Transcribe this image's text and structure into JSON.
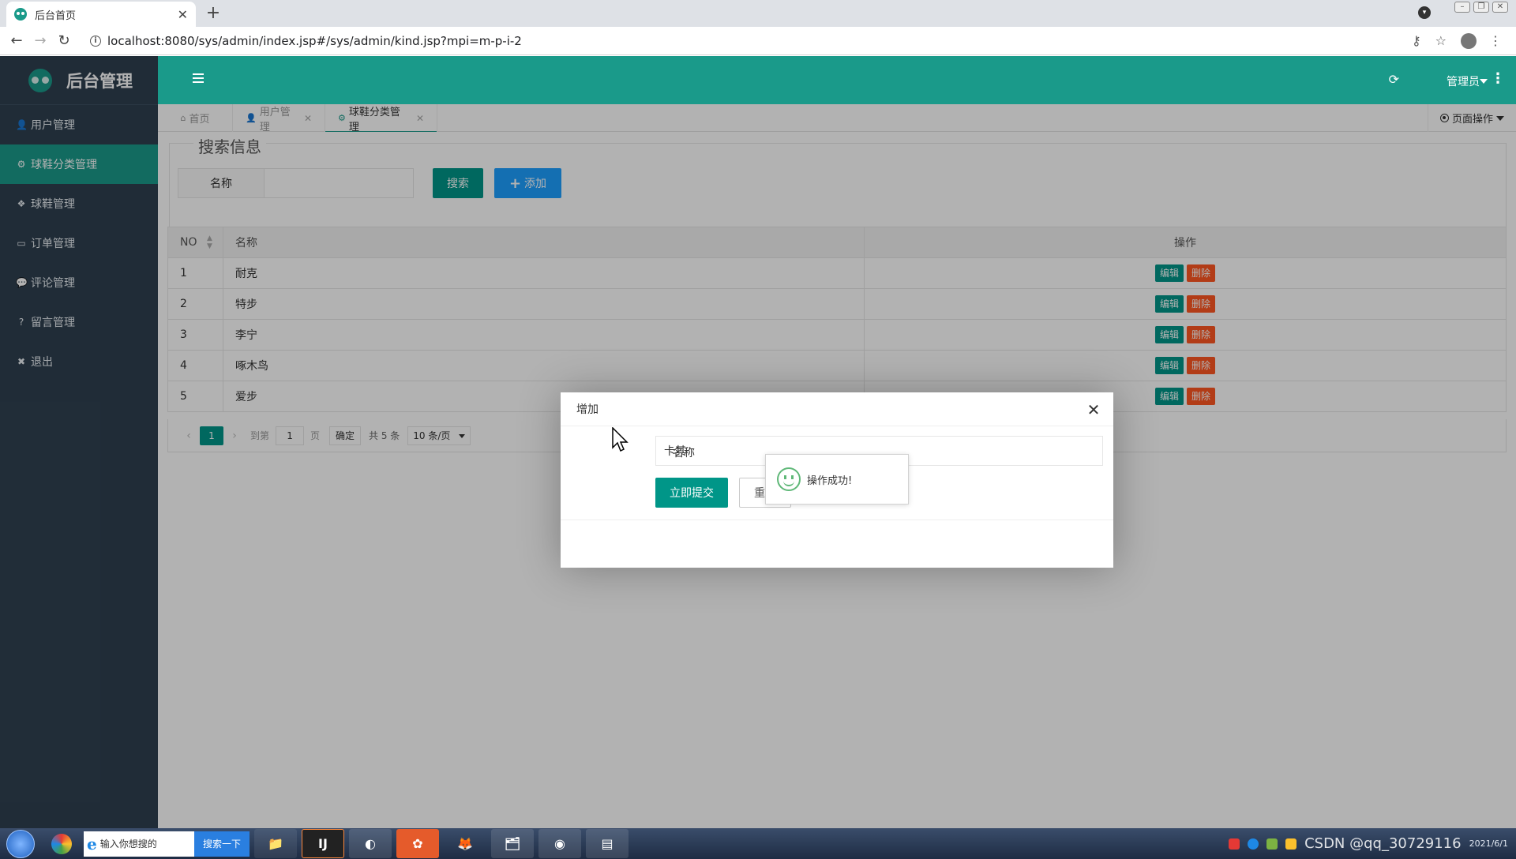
{
  "browser": {
    "tab_title": "后台首页",
    "url": "localhost:8080/sys/admin/index.jsp#/sys/admin/kind.jsp?mpi=m-p-i-2"
  },
  "app": {
    "brand": "后台管理",
    "admin_user": "管理员"
  },
  "sidebar": {
    "items": [
      {
        "label": "用户管理",
        "icon": "user-icon",
        "glyph": "👤"
      },
      {
        "label": "球鞋分类管理",
        "icon": "cogs-icon",
        "glyph": "⚙"
      },
      {
        "label": "球鞋管理",
        "icon": "cubes-icon",
        "glyph": "❖"
      },
      {
        "label": "订单管理",
        "icon": "credit-card-icon",
        "glyph": "▭"
      },
      {
        "label": "评论管理",
        "icon": "comments-icon",
        "glyph": "💬"
      },
      {
        "label": "留言管理",
        "icon": "question-icon",
        "glyph": "?"
      },
      {
        "label": "退出",
        "icon": "close-square-icon",
        "glyph": "✖"
      }
    ],
    "active_index": 1
  },
  "page_tabs": {
    "home": "首页",
    "user": "用户管理",
    "kind": "球鞋分类管理",
    "page_ops": "页面操作"
  },
  "search": {
    "legend": "搜索信息",
    "name_label": "名称",
    "search_button": "搜索",
    "add_button": "添加"
  },
  "table": {
    "headers": [
      "NO",
      "名称",
      "操作"
    ],
    "rows": [
      {
        "no": "1",
        "name": "耐克"
      },
      {
        "no": "2",
        "name": "特步"
      },
      {
        "no": "3",
        "name": "李宁"
      },
      {
        "no": "4",
        "name": "啄木鸟"
      },
      {
        "no": "5",
        "name": "爱步"
      }
    ],
    "edit_label": "编辑",
    "delete_label": "删除"
  },
  "pager": {
    "current_page": "1",
    "goto_prefix": "到第",
    "goto_value": "1",
    "goto_suffix": "页",
    "confirm": "确定",
    "total": "共 5 条",
    "page_size": "10 条/页"
  },
  "modal": {
    "title": "增加",
    "name_label": "名称",
    "name_value": "卡其",
    "submit": "立即提交",
    "reset": "重置"
  },
  "toast": {
    "message": "操作成功!"
  },
  "taskbar": {
    "search_placeholder": "输入你想搜的",
    "search_button": "搜索一下",
    "watermark": "CSDN @qq_30729116",
    "date": "2021/6/1"
  },
  "colors": {
    "primary": "#009688",
    "sidebar": "#2f4050",
    "add": "#1e9fff",
    "danger": "#ff5722"
  }
}
